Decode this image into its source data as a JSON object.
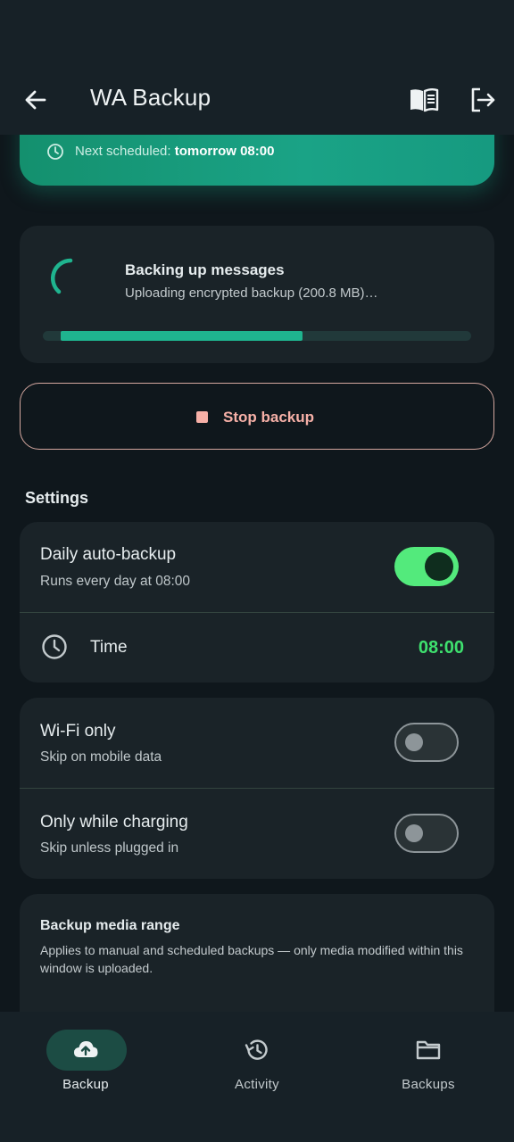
{
  "appbar": {
    "title": "WA Backup"
  },
  "status_card": {
    "prefix": "Next scheduled:",
    "value": "tomorrow 08:00"
  },
  "progress": {
    "title": "Backing up messages",
    "subtitle": "Uploading encrypted backup (200.8 MB)…",
    "fraction": 0.59
  },
  "stop_button": {
    "label": "Stop backup"
  },
  "settings": {
    "section_title": "Settings",
    "daily": {
      "title": "Daily auto-backup",
      "subtitle": "Runs every day at 08:00",
      "enabled": true
    },
    "time": {
      "label": "Time",
      "value": "08:00"
    },
    "wifi": {
      "title": "Wi-Fi only",
      "subtitle": "Skip on mobile data",
      "enabled": false
    },
    "charging": {
      "title": "Only while charging",
      "subtitle": "Skip unless plugged in",
      "enabled": false
    }
  },
  "media_range": {
    "title": "Backup media range",
    "description": "Applies to manual and scheduled backups — only media modified within this window is uploaded."
  },
  "bottom_nav": {
    "items": [
      {
        "label": "Backup",
        "icon": "cloud-upload-icon",
        "active": true
      },
      {
        "label": "Activity",
        "icon": "history-icon",
        "active": false
      },
      {
        "label": "Backups",
        "icon": "folder-icon",
        "active": false
      }
    ]
  },
  "colors": {
    "accent": "#1fb48f",
    "switch_on": "#53ea7c",
    "stop": "#f6b0a7",
    "time_value": "#3ee06e"
  }
}
